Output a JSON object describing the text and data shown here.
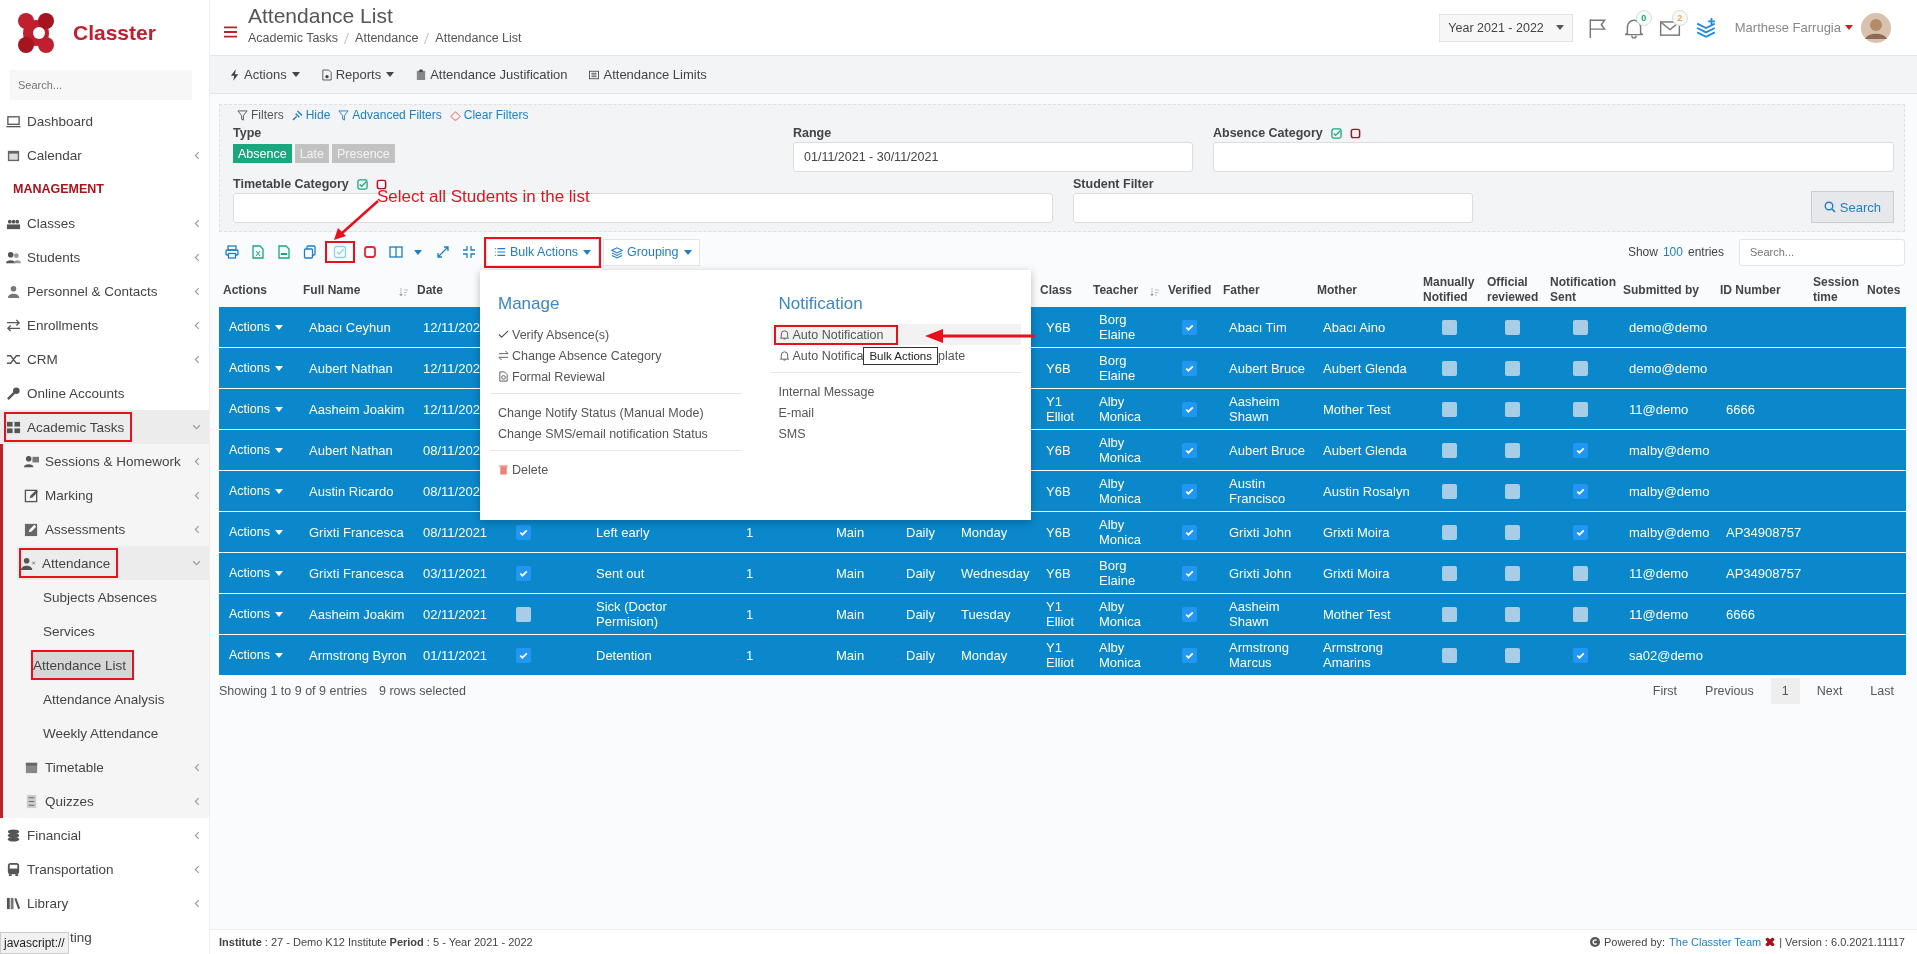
{
  "header": {
    "title": "Attendance List",
    "breadcrumbs": [
      "Academic Tasks",
      "Attendance",
      "Attendance List"
    ],
    "year": "Year 2021 - 2022",
    "notifications_badge": "0",
    "messages_badge": "2",
    "user": "Marthese Farrugia"
  },
  "sidebar": {
    "logo": "Classter",
    "search_placeholder": "Search...",
    "items": [
      {
        "label": "Dashboard",
        "kind": "link",
        "submenu": false,
        "selected": false,
        "annotated": false
      },
      {
        "label": "Calendar",
        "kind": "link",
        "submenu": true,
        "selected": false,
        "annotated": false
      },
      {
        "label": "MANAGEMENT",
        "kind": "heading"
      },
      {
        "label": "Classes",
        "kind": "link",
        "submenu": true,
        "selected": false,
        "annotated": false
      },
      {
        "label": "Students",
        "kind": "link",
        "submenu": true,
        "selected": false,
        "annotated": false
      },
      {
        "label": "Personnel & Contacts",
        "kind": "link",
        "submenu": true,
        "selected": false,
        "annotated": false
      },
      {
        "label": "Enrollments",
        "kind": "link",
        "submenu": true,
        "selected": false,
        "annotated": false
      },
      {
        "label": "CRM",
        "kind": "link",
        "submenu": true,
        "selected": false,
        "annotated": false
      },
      {
        "label": "Online Accounts",
        "kind": "link",
        "submenu": false,
        "selected": false,
        "annotated": false
      },
      {
        "label": "Academic Tasks",
        "kind": "link",
        "submenu": true,
        "expanded": true,
        "selected": false,
        "annotated": true,
        "children": [
          {
            "label": "Sessions & Homework",
            "submenu": true,
            "selected": false,
            "annotated": false
          },
          {
            "label": "Marking",
            "submenu": true,
            "selected": false,
            "annotated": false
          },
          {
            "label": "Assessments",
            "submenu": true,
            "selected": false,
            "annotated": false
          },
          {
            "label": "Attendance",
            "submenu": true,
            "expanded": true,
            "selected": false,
            "annotated": true,
            "children": [
              {
                "label": "Subjects Absences",
                "selected": false,
                "annotated": false
              },
              {
                "label": "Services",
                "selected": false,
                "annotated": false
              },
              {
                "label": "Attendance List",
                "selected": true,
                "annotated": true
              },
              {
                "label": "Attendance Analysis",
                "selected": false,
                "annotated": false
              },
              {
                "label": "Weekly Attendance",
                "selected": false,
                "annotated": false
              }
            ]
          },
          {
            "label": "Timetable",
            "submenu": true,
            "selected": false,
            "annotated": false
          },
          {
            "label": "Quizzes",
            "submenu": true,
            "selected": false,
            "annotated": false
          }
        ]
      },
      {
        "label": "Financial",
        "kind": "link",
        "submenu": true,
        "selected": false,
        "annotated": false
      },
      {
        "label": "Transportation",
        "kind": "link",
        "submenu": true,
        "selected": false,
        "annotated": false
      },
      {
        "label": "Library",
        "kind": "link",
        "submenu": true,
        "selected": false,
        "annotated": false
      },
      {
        "label": "ting",
        "kind": "link",
        "submenu": false,
        "selected": false,
        "annotated": false
      }
    ]
  },
  "toolbar": {
    "menus": [
      {
        "label": "Actions",
        "dropdown": true
      },
      {
        "label": "Reports",
        "dropdown": true
      },
      {
        "label": "Attendance Justification",
        "dropdown": false
      },
      {
        "label": "Attendance Limits",
        "dropdown": false
      }
    ]
  },
  "filters": {
    "links": [
      "Filters",
      "Hide",
      "Advanced Filters",
      "Clear Filters"
    ],
    "type_label": "Type",
    "types": [
      {
        "label": "Absence",
        "selected": true
      },
      {
        "label": "Late",
        "selected": false
      },
      {
        "label": "Presence",
        "selected": false
      }
    ],
    "range": {
      "label": "Range",
      "value": "01/11/2021 - 30/11/2021"
    },
    "absence_category": {
      "label": "Absence Category"
    },
    "timetable_category": {
      "label": "Timetable Category"
    },
    "student_filter": {
      "label": "Student Filter"
    },
    "search_button": "Search"
  },
  "table_toolbar": {
    "select_all_annotated": true,
    "bulk_actions": "Bulk Actions",
    "bulk_actions_annotated": true,
    "grouping": "Grouping",
    "show": "Show",
    "page_size": "100",
    "entries": "entries",
    "search_placeholder": "Search..."
  },
  "bulk_menu": {
    "sections": [
      {
        "heading": "Manage",
        "groups": [
          [
            {
              "label": "Verify Absence(s)",
              "kind": "check",
              "hovered": false,
              "annotated": false
            },
            {
              "label": "Change Absence Category",
              "kind": "swap",
              "hovered": false,
              "annotated": false
            },
            {
              "label": "Formal Reviewal",
              "kind": "review",
              "hovered": false,
              "annotated": false
            }
          ],
          [
            {
              "label": "Change Notify Status (Manual Mode)",
              "kind": "plain",
              "hovered": false,
              "annotated": false
            },
            {
              "label": "Change SMS/email notification Status",
              "kind": "plain",
              "hovered": false,
              "annotated": false
            }
          ],
          [
            {
              "label": "Delete",
              "kind": "delete",
              "hovered": false,
              "annotated": false
            }
          ]
        ]
      },
      {
        "heading": "Notification",
        "groups": [
          [
            {
              "label": "Auto Notification",
              "kind": "bell",
              "hovered": true,
              "annotated": true
            },
            {
              "label": "Auto Notifica",
              "kind": "bell",
              "hovered": false,
              "annotated": false,
              "tooltip": "Bulk Actions",
              "label_after_tooltip": "plate"
            }
          ],
          [
            {
              "label": "Internal Message",
              "kind": "plain",
              "hovered": false,
              "annotated": false
            },
            {
              "label": "E-mail",
              "kind": "plain",
              "hovered": false,
              "annotated": false
            },
            {
              "label": "SMS",
              "kind": "plain",
              "hovered": false,
              "annotated": false
            }
          ]
        ]
      }
    ]
  },
  "table": {
    "columns": [
      {
        "label": "Actions",
        "sort_icon": false
      },
      {
        "label": "Full Name",
        "sort_icon": true
      },
      {
        "label": "Date"
      },
      {
        "label": "Class",
        "sort_icon": false
      },
      {
        "label": "Teacher",
        "sort_icon": true
      },
      {
        "label": "Verified",
        "sort_icon": false
      },
      {
        "label": "Father",
        "sort_icon": false
      },
      {
        "label": "Mother",
        "sort_icon": false
      },
      {
        "label": "Manually Notified",
        "sort_icon": false
      },
      {
        "label": "Official reviewed",
        "sort_icon": false
      },
      {
        "label": "Notification Sent",
        "sort_icon": false
      },
      {
        "label": "Submitted by",
        "sort_icon": false
      },
      {
        "label": "ID Number",
        "sort_icon": false
      },
      {
        "label": "Session time",
        "sort_icon": false
      },
      {
        "label": "Notes",
        "sort_icon": false
      }
    ],
    "rows": [
      {
        "selected": true,
        "actions": "Actions",
        "name": "Abacı Ceyhun",
        "date": "12/11/202",
        "class": "Y6B",
        "teacher": "Borg Elaine",
        "verified": true,
        "father": "Abacı Tim",
        "mother": "Abacı Aino",
        "manually_notified": false,
        "official_reviewed": false,
        "notification_sent": false,
        "submitted_by": "demo@demo"
      },
      {
        "selected": true,
        "actions": "Actions",
        "name": "Aubert Nathan",
        "date": "12/11/202",
        "class": "Y6B",
        "teacher": "Borg Elaine",
        "verified": true,
        "father": "Aubert Bruce",
        "mother": "Aubert Glenda",
        "manually_notified": false,
        "official_reviewed": false,
        "notification_sent": false,
        "submitted_by": "demo@demo"
      },
      {
        "selected": true,
        "actions": "Actions",
        "name": "Aasheim Joakim",
        "date": "12/11/202",
        "class": "Y1 Elliot",
        "teacher": "Alby Monica",
        "verified": true,
        "father": "Aasheim Shawn",
        "mother": "Mother Test",
        "manually_notified": false,
        "official_reviewed": false,
        "notification_sent": false,
        "submitted_by": "11@demo",
        "id_number": "6666"
      },
      {
        "selected": true,
        "actions": "Actions",
        "name": "Aubert Nathan",
        "date": "08/11/202",
        "class": "Y6B",
        "teacher": "Alby Monica",
        "verified": true,
        "father": "Aubert Bruce",
        "mother": "Aubert Glenda",
        "manually_notified": false,
        "official_reviewed": false,
        "notification_sent": true,
        "submitted_by": "malby@demo"
      },
      {
        "selected": true,
        "actions": "Actions",
        "name": "Austin Ricardo",
        "date": "08/11/202",
        "class": "Y6B",
        "teacher": "Alby Monica",
        "verified": true,
        "father": "Austin Francisco",
        "mother": "Austin Rosalyn",
        "manually_notified": false,
        "official_reviewed": false,
        "notification_sent": true,
        "submitted_by": "malby@demo"
      },
      {
        "selected": true,
        "actions": "Actions",
        "name": "Grixti Francesca",
        "date": "08/11/2021",
        "column_4_checked": true,
        "column_5": "Left early",
        "column_6": "1",
        "column_7": "Main",
        "column_8": "Daily",
        "column_9": "Monday",
        "class": "Y6B",
        "teacher": "Alby Monica",
        "verified": true,
        "father": "Grixti John",
        "mother": "Grixti Moira",
        "manually_notified": false,
        "official_reviewed": false,
        "notification_sent": true,
        "submitted_by": "malby@demo",
        "id_number": "AP34908757"
      },
      {
        "selected": true,
        "actions": "Actions",
        "name": "Grixti Francesca",
        "date": "03/11/2021",
        "column_4_checked": true,
        "column_5": "Sent out",
        "column_6": "1",
        "column_7": "Main",
        "column_8": "Daily",
        "column_9": "Wednesday",
        "class": "Y6B",
        "teacher": "Borg Elaine",
        "verified": true,
        "father": "Grixti John",
        "mother": "Grixti Moira",
        "manually_notified": false,
        "official_reviewed": false,
        "notification_sent": false,
        "submitted_by": "11@demo",
        "id_number": "AP34908757"
      },
      {
        "selected": true,
        "actions": "Actions",
        "name": "Aasheim Joakim",
        "date": "02/11/2021",
        "column_4_checked": false,
        "column_5": "Sick (Doctor Permision)",
        "column_6": "1",
        "column_7": "Main",
        "column_8": "Daily",
        "column_9": "Tuesday",
        "class": "Y1 Elliot",
        "teacher": "Alby Monica",
        "verified": true,
        "father": "Aasheim Shawn",
        "mother": "Mother Test",
        "manually_notified": false,
        "official_reviewed": false,
        "notification_sent": false,
        "submitted_by": "11@demo",
        "id_number": "6666"
      },
      {
        "selected": true,
        "actions": "Actions",
        "name": "Armstrong Byron",
        "date": "01/11/2021",
        "column_4_checked": true,
        "column_5": "Detention",
        "column_6": "1",
        "column_7": "Main",
        "column_8": "Daily",
        "column_9": "Monday",
        "class": "Y1 Elliot",
        "teacher": "Alby Monica",
        "verified": true,
        "father": "Armstrong Marcus",
        "mother": "Armstrong Amarins",
        "manually_notified": false,
        "official_reviewed": false,
        "notification_sent": true,
        "submitted_by": "sa02@demo"
      }
    ],
    "info": "Showing 1 to 9 of 9 entries",
    "selection_info": "9 rows selected",
    "pagination": [
      {
        "label": "First",
        "selected": false
      },
      {
        "label": "Previous",
        "selected": false
      },
      {
        "label": "1",
        "selected": true
      },
      {
        "label": "Next",
        "selected": false
      },
      {
        "label": "Last",
        "selected": false
      }
    ]
  },
  "annotation": {
    "note": "Select all Students in the list"
  },
  "footer": {
    "institute": "**Institute** : 27 - Demo K12 Institute **Period** : 5 - Year 2021 - 2022",
    "powered_by": "Powered by:",
    "team": "The Classter Team",
    "version": "| Version : 6.0.2021.11117"
  },
  "browser_status": "javascript://"
}
